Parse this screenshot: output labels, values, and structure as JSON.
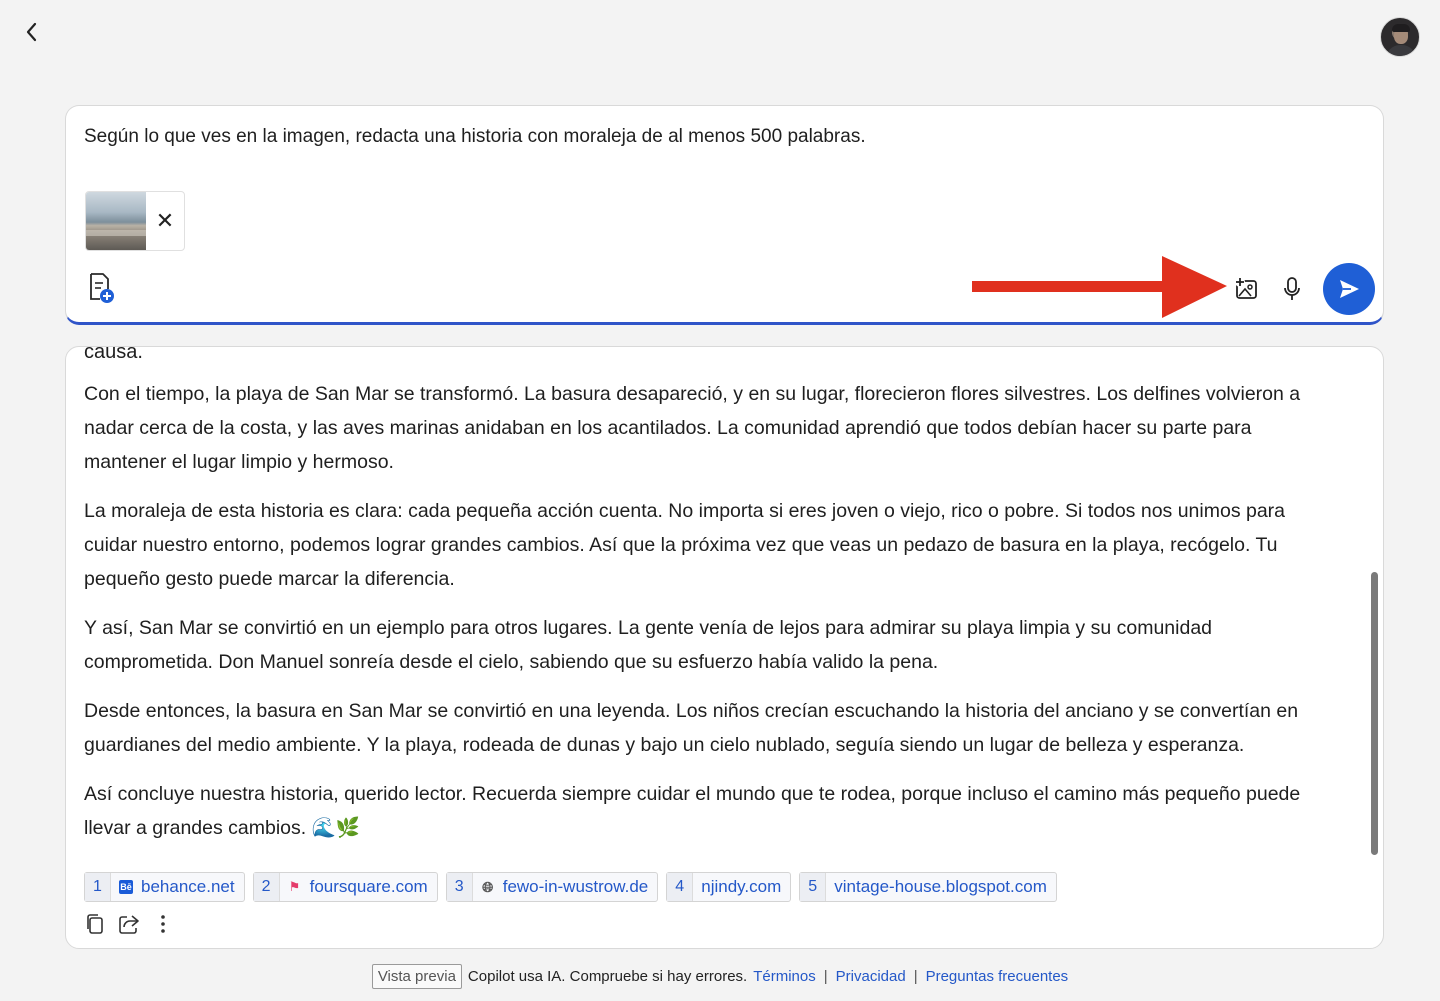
{
  "composer": {
    "prompt": "Según lo que ves en la imagen, redacta una historia con moraleja de al menos 500 palabras.",
    "remove_attachment": "✕"
  },
  "response": {
    "cut_word": "causa.",
    "paragraphs": [
      "Con el tiempo, la playa de San Mar se transformó. La basura desapareció, y en su lugar, florecieron flores silvestres. Los delfines volvieron a nadar cerca de la costa, y las aves marinas anidaban en los acantilados. La comunidad aprendió que todos debían hacer su parte para mantener el lugar limpio y hermoso.",
      "La moraleja de esta historia es clara: cada pequeña acción cuenta. No importa si eres joven o viejo, rico o pobre. Si todos nos unimos para cuidar nuestro entorno, podemos lograr grandes cambios. Así que la próxima vez que veas un pedazo de basura en la playa, recógelo. Tu pequeño gesto puede marcar la diferencia.",
      "Y así, San Mar se convirtió en un ejemplo para otros lugares. La gente venía de lejos para admirar su playa limpia y su comunidad comprometida. Don Manuel sonreía desde el cielo, sabiendo que su esfuerzo había valido la pena.",
      "Desde entonces, la basura en San Mar se convirtió en una leyenda. Los niños crecían escuchando la historia del anciano y se convertían en guardianes del medio ambiente. Y la playa, rodeada de dunas y bajo un cielo nublado, seguía siendo un lugar de belleza y esperanza.",
      "Así concluye nuestra historia, querido lector. Recuerda siempre cuidar el mundo que te rodea, porque incluso el camino más pequeño puede llevar a grandes cambios. 🌊🌿"
    ],
    "citations": [
      {
        "num": "1",
        "label": "behance.net",
        "icon": "behance-icon"
      },
      {
        "num": "2",
        "label": "foursquare.com",
        "icon": "foursquare-icon"
      },
      {
        "num": "3",
        "label": "fewo-in-wustrow.de",
        "icon": "globe-icon"
      },
      {
        "num": "4",
        "label": "njindy.com",
        "icon": "none"
      },
      {
        "num": "5",
        "label": "vintage-house.blogspot.com",
        "icon": "none"
      }
    ]
  },
  "footer": {
    "badge": "Vista previa",
    "notice": "Copilot usa IA. Compruebe si hay errores.",
    "terms": "Términos",
    "privacy": "Privacidad",
    "faq": "Preguntas frecuentes",
    "separator": "|"
  },
  "colors": {
    "accent": "#1f5fd6",
    "link": "#2458c8",
    "annotation_arrow": "#e0301e",
    "background": "#f3f3f3"
  }
}
